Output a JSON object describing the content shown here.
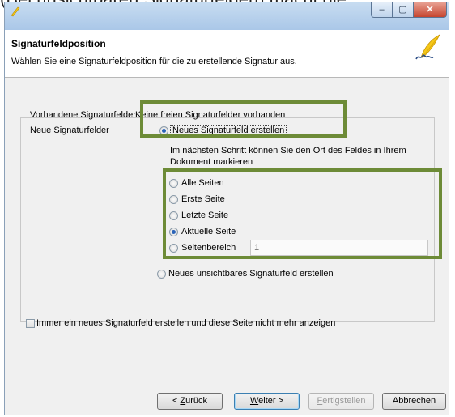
{
  "page_caption": "(Bei unsichtbaren Signaturfeldern macht die",
  "window": {
    "controls": {
      "minimize": "–",
      "maximize": "▢",
      "close": "✕"
    }
  },
  "header": {
    "title": "Signaturfeldposition",
    "description": "Wählen Sie eine Signaturfeldposition für die zu erstellende Signatur aus."
  },
  "form": {
    "existing_label": "Vorhandene Signaturfelder",
    "existing_value": "Keine freien Signaturfelder vorhanden",
    "new_label": "Neue Signaturfelder",
    "option_new_field": "Neues Signaturfeld erstellen",
    "hint_line1": "Im nächsten Schritt können Sie den Ort des Feldes in Ihrem",
    "hint_line2": "Dokument markieren",
    "page_options": [
      {
        "label": "Alle Seiten",
        "checked": false
      },
      {
        "label": "Erste Seite",
        "checked": false
      },
      {
        "label": "Letzte Seite",
        "checked": false
      },
      {
        "label": "Aktuelle Seite",
        "checked": true
      },
      {
        "label": "Seitenbereich",
        "checked": false
      }
    ],
    "page_range_value": "1",
    "option_invisible_field": "Neues unsichtbares Signaturfeld erstellen",
    "always_new_checkbox": "Immer ein neues Signaturfeld erstellen und diese Seite nicht mehr anzeigen"
  },
  "buttons": {
    "back": {
      "prefix": "< ",
      "mnemonic": "Z",
      "rest": "urück"
    },
    "next": {
      "mnemonic": "W",
      "rest": "eiter >"
    },
    "finish": {
      "mnemonic": "F",
      "rest": "ertigstellen",
      "disabled": true
    },
    "cancel": "Abbrechen"
  },
  "highlight_color": "#6d8b37",
  "icons": [
    "app-icon",
    "pen-logo-icon"
  ]
}
